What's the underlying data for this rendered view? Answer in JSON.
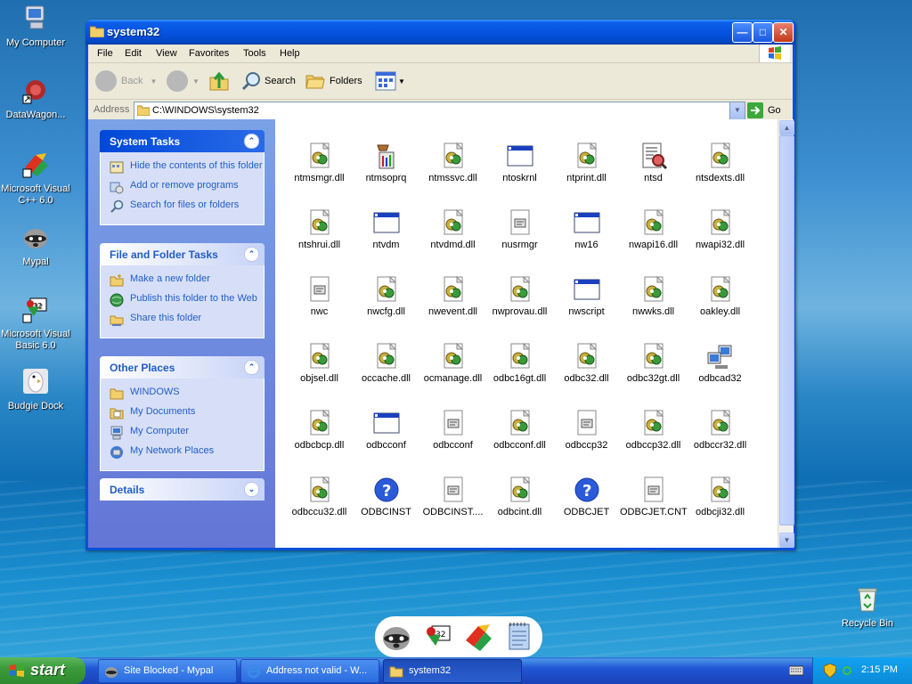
{
  "desktop": {
    "icons": [
      {
        "label": "My Computer"
      },
      {
        "label": "DataWagon..."
      },
      {
        "label": "Microsoft Visual C++ 6.0"
      },
      {
        "label": "Mypal"
      },
      {
        "label": "Microsoft Visual Basic 6.0"
      },
      {
        "label": "Budgie Dock"
      },
      {
        "label": "Recycle Bin"
      }
    ]
  },
  "window": {
    "title": "system32",
    "menu": [
      "File",
      "Edit",
      "View",
      "Favorites",
      "Tools",
      "Help"
    ],
    "toolbar": {
      "back": "Back",
      "search": "Search",
      "folders": "Folders"
    },
    "address": {
      "label": "Address",
      "value": "C:\\WINDOWS\\system32",
      "go": "Go"
    },
    "taskpane": {
      "system_tasks": {
        "title": "System Tasks",
        "items": [
          "Hide the contents of this folder",
          "Add or remove programs",
          "Search for files or folders"
        ]
      },
      "file_folder_tasks": {
        "title": "File and Folder Tasks",
        "items": [
          "Make a new folder",
          "Publish this folder to the Web",
          "Share this folder"
        ]
      },
      "other_places": {
        "title": "Other Places",
        "items": [
          "WINDOWS",
          "My Documents",
          "My Computer",
          "My Network Places"
        ]
      },
      "details": {
        "title": "Details"
      }
    },
    "files": [
      [
        "ntmsmgr.dll",
        "ntmsoprq",
        "ntmssvc.dll",
        "ntoskrnl",
        "ntprint.dll",
        "ntsd",
        "ntsdexts.dll"
      ],
      [
        "ntshrui.dll",
        "ntvdm",
        "ntvdmd.dll",
        "nusrmgr",
        "nw16",
        "nwapi16.dll",
        "nwapi32.dll"
      ],
      [
        "nwc",
        "nwcfg.dll",
        "nwevent.dll",
        "nwprovau.dll",
        "nwscript",
        "nwwks.dll",
        "oakley.dll"
      ],
      [
        "objsel.dll",
        "occache.dll",
        "ocmanage.dll",
        "odbc16gt.dll",
        "odbc32.dll",
        "odbc32gt.dll",
        "odbcad32"
      ],
      [
        "odbcbcp.dll",
        "odbcconf",
        "odbcconf",
        "odbcconf.dll",
        "odbccp32",
        "odbccp32.dll",
        "odbccr32.dll"
      ],
      [
        "odbccu32.dll",
        "ODBCINST",
        "ODBCINST....",
        "odbcint.dll",
        "ODBCJET",
        "ODBCJET.CNT",
        "odbcji32.dll"
      ]
    ],
    "file_icons": [
      [
        "dll",
        "app-tool",
        "dll",
        "exe",
        "dll",
        "doc-search",
        "dll"
      ],
      [
        "dll",
        "exe",
        "dll",
        "cfg",
        "exe",
        "dll",
        "dll"
      ],
      [
        "cfg",
        "dll",
        "dll",
        "dll",
        "exe",
        "dll",
        "dll"
      ],
      [
        "dll",
        "dll",
        "dll",
        "dll",
        "dll",
        "dll",
        "network-pc"
      ],
      [
        "dll",
        "exe",
        "cfg",
        "dll",
        "cfg",
        "dll",
        "dll"
      ],
      [
        "dll",
        "help",
        "cfg",
        "dll",
        "help",
        "cfg",
        "dll"
      ]
    ]
  },
  "taskbar": {
    "start": "start",
    "tasks": [
      "Site Blocked - Mypal",
      "Address not valid - W...",
      "system32"
    ],
    "clock": "2:15 PM"
  },
  "colors": {
    "xp_blue": "#0b50d8",
    "taskpane_link": "#215dc6",
    "start_green": "#3c9b3c"
  }
}
